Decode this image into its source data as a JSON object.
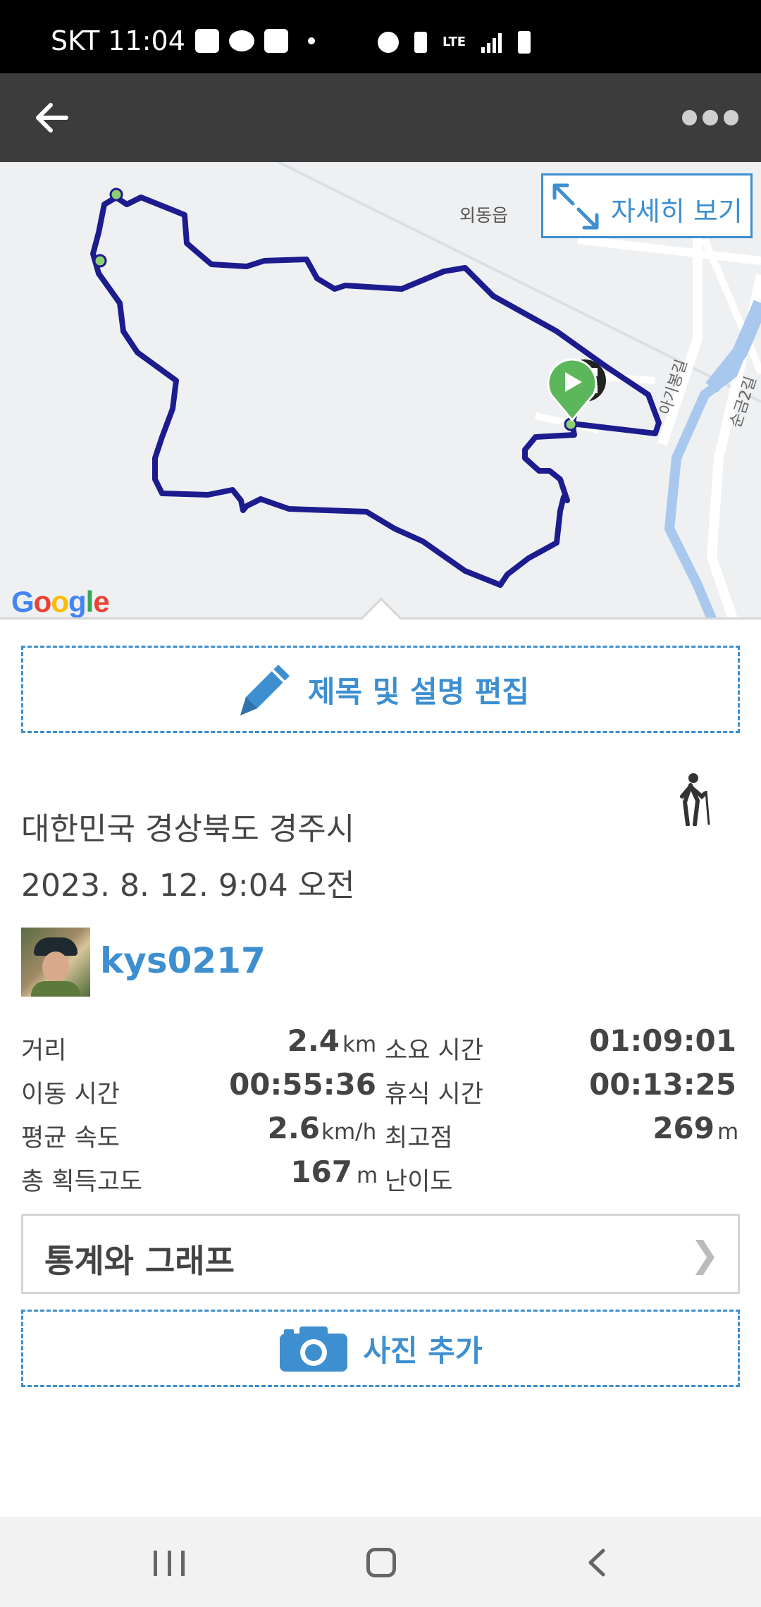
{
  "status_bar": {
    "carrier_time": "SKT 11:04",
    "network": "LTE"
  },
  "map": {
    "detail_button_label": "자세히 보기",
    "place_label": "외동읍",
    "road_label_1": "아기봉길",
    "road_label_2": "순금2길",
    "google_logo": "Google"
  },
  "edit": {
    "label": "제목 및 설명 편집"
  },
  "record": {
    "location": "대한민국 경상북도 경주시",
    "datetime": "2023. 8. 12. 9:04 오전"
  },
  "user": {
    "name": "kys0217"
  },
  "stats": [
    {
      "label": "거리",
      "value": "2.4",
      "unit": "km",
      "label2": "소요 시간",
      "value2": "01:09:01",
      "unit2": ""
    },
    {
      "label": "이동 시간",
      "value": "00:55:36",
      "unit": "",
      "label2": "휴식 시간",
      "value2": "00:13:25",
      "unit2": ""
    },
    {
      "label": "평균 속도",
      "value": "2.6",
      "unit": "km/h",
      "label2": "최고점",
      "value2": "269",
      "unit2": "m"
    },
    {
      "label": "총 획득고도",
      "value": "167",
      "unit": "m",
      "label2": "난이도",
      "value2": "",
      "unit2": ""
    }
  ],
  "graph_button": {
    "label": "통계와 그래프",
    "chevron": "❯"
  },
  "photo_button": {
    "label": "사진 추가"
  },
  "colors": {
    "accent": "#3d8fd0",
    "route": "#1c1c8f",
    "app_bar": "#3c3c3c"
  }
}
